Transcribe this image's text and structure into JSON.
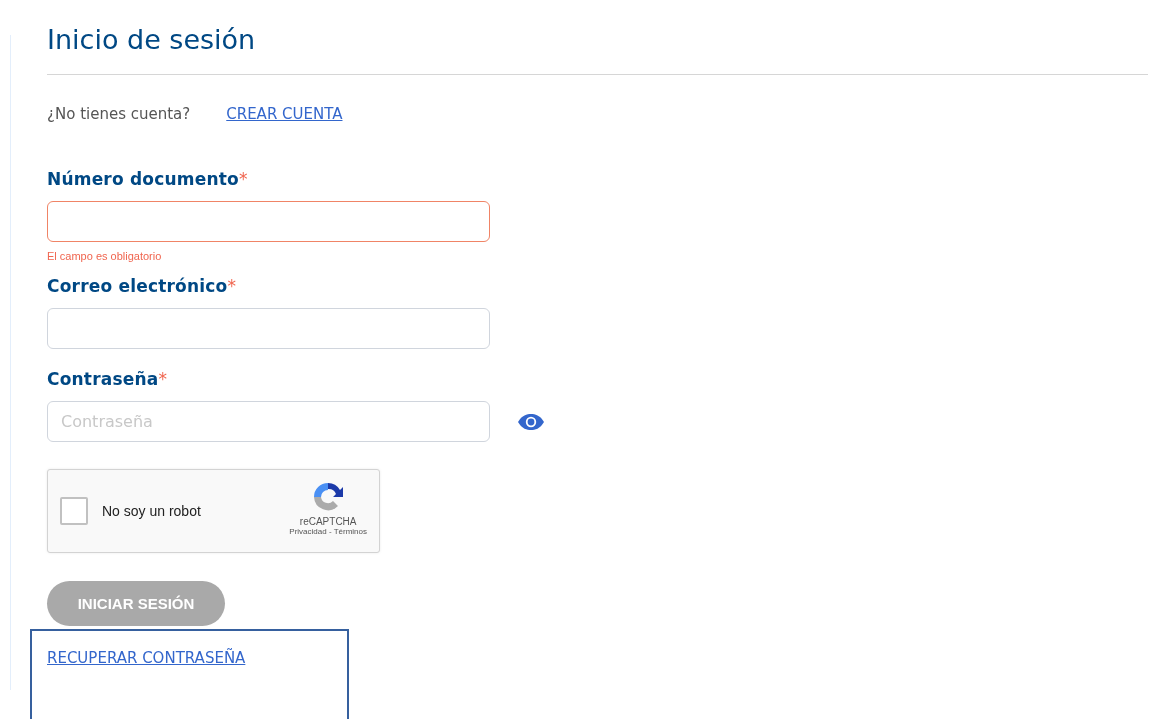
{
  "title": "Inicio de sesión",
  "signup": {
    "prompt": "¿No tienes cuenta?",
    "link": "CREAR CUENTA"
  },
  "fields": [
    {
      "label": "Número documento",
      "required_mark": "*",
      "kind": "text",
      "invalid": true,
      "error": "El campo es obligatorio"
    },
    {
      "label": "Correo electrónico",
      "required_mark": "*",
      "kind": "text",
      "invalid": false
    },
    {
      "label": "Contraseña",
      "required_mark": "*",
      "kind": "password",
      "invalid": false,
      "placeholder": "Contraseña"
    }
  ],
  "captcha": {
    "label": "No soy un robot",
    "checked": false,
    "brand": "reCAPTCHA",
    "links": "Privacidad - Términos"
  },
  "submit": {
    "label": "INICIAR SESIÓN",
    "disabled": true
  },
  "recover_link": "RECUPERAR CONTRASEÑA"
}
